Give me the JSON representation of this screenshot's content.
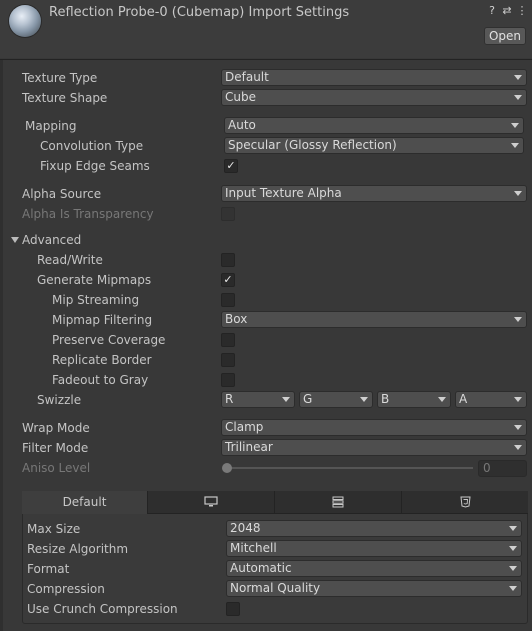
{
  "header": {
    "title": "Reflection Probe-0 (Cubemap) Import Settings",
    "help_icon": "?",
    "settings_icon": "⇄",
    "more_icon": "⋮",
    "open_label": "Open"
  },
  "fields": {
    "texture_type": {
      "label": "Texture Type",
      "value": "Default"
    },
    "texture_shape": {
      "label": "Texture Shape",
      "value": "Cube"
    },
    "mapping": {
      "label": "Mapping",
      "value": "Auto"
    },
    "convolution_type": {
      "label": "Convolution Type",
      "value": "Specular (Glossy Reflection)"
    },
    "fixup_edge_seams": {
      "label": "Fixup Edge Seams",
      "checked": true
    },
    "alpha_source": {
      "label": "Alpha Source",
      "value": "Input Texture Alpha"
    },
    "alpha_is_transparency": {
      "label": "Alpha Is Transparency",
      "checked": false
    }
  },
  "advanced": {
    "label": "Advanced",
    "read_write": {
      "label": "Read/Write",
      "checked": false
    },
    "generate_mipmaps": {
      "label": "Generate Mipmaps",
      "checked": true
    },
    "mip_streaming": {
      "label": "Mip Streaming",
      "checked": false
    },
    "mipmap_filtering": {
      "label": "Mipmap Filtering",
      "value": "Box"
    },
    "preserve_coverage": {
      "label": "Preserve Coverage",
      "checked": false
    },
    "replicate_border": {
      "label": "Replicate Border",
      "checked": false
    },
    "fadeout_to_gray": {
      "label": "Fadeout to Gray",
      "checked": false
    },
    "swizzle": {
      "label": "Swizzle",
      "r": "R",
      "g": "G",
      "b": "B",
      "a": "A"
    }
  },
  "sampling": {
    "wrap_mode": {
      "label": "Wrap Mode",
      "value": "Clamp"
    },
    "filter_mode": {
      "label": "Filter Mode",
      "value": "Trilinear"
    },
    "aniso_level": {
      "label": "Aniso Level",
      "value": "0"
    }
  },
  "platform": {
    "tabs": [
      {
        "label": "Default",
        "icon": ""
      },
      {
        "label": "",
        "icon": "monitor-icon"
      },
      {
        "label": "",
        "icon": "server-icon"
      },
      {
        "label": "",
        "icon": "html5-icon"
      }
    ],
    "max_size": {
      "label": "Max Size",
      "value": "2048"
    },
    "resize_algorithm": {
      "label": "Resize Algorithm",
      "value": "Mitchell"
    },
    "format": {
      "label": "Format",
      "value": "Automatic"
    },
    "compression": {
      "label": "Compression",
      "value": "Normal Quality"
    },
    "use_crunch": {
      "label": "Use Crunch Compression",
      "checked": false
    }
  }
}
